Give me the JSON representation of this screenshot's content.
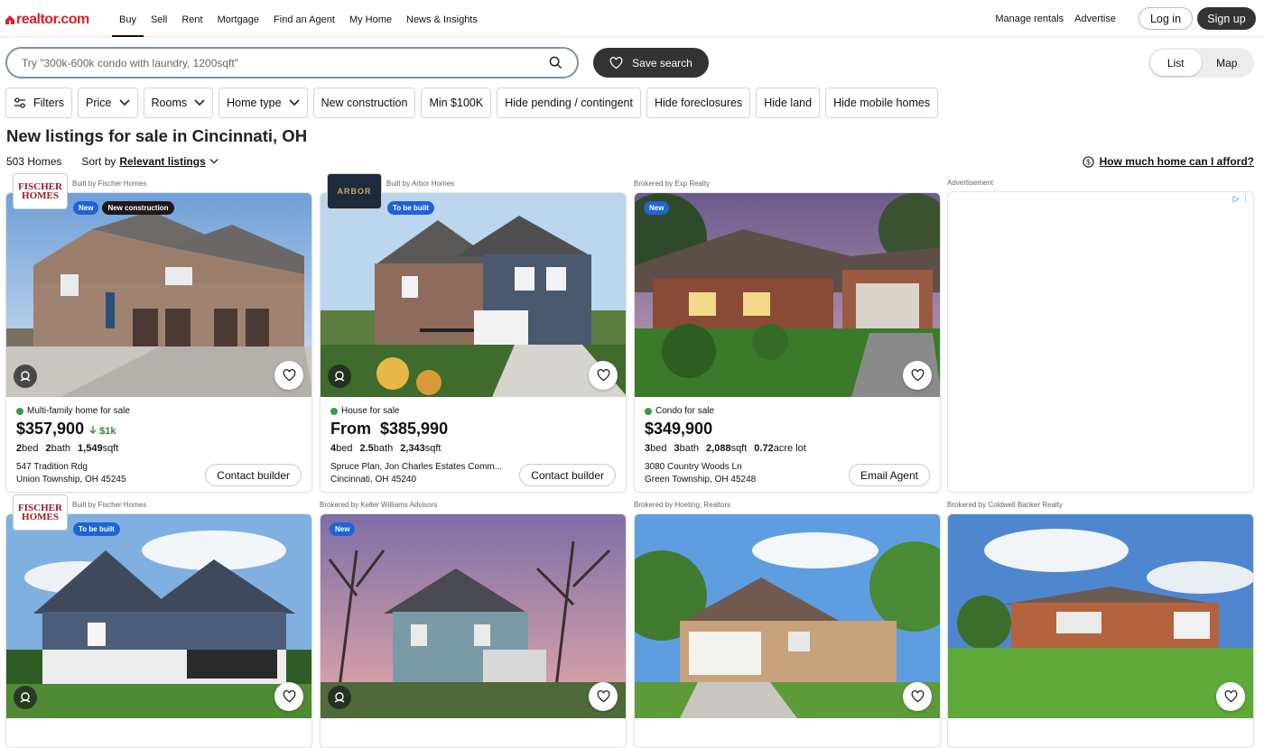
{
  "header": {
    "logo": "realtor.com",
    "nav": [
      "Buy",
      "Sell",
      "Rent",
      "Mortgage",
      "Find an Agent",
      "My Home",
      "News & Insights"
    ],
    "right_links": [
      "Manage rentals",
      "Advertise"
    ],
    "login": "Log in",
    "signup": "Sign up"
  },
  "search": {
    "placeholder": "Try \"300k-600k condo with laundry, 1200sqft\"",
    "save_search": "Save search",
    "view_list": "List",
    "view_map": "Map"
  },
  "filters": [
    "Filters",
    "Price",
    "Rooms",
    "Home type",
    "New construction",
    "Min $100K",
    "Hide pending / contingent",
    "Hide foreclosures",
    "Hide land",
    "Hide mobile homes"
  ],
  "page_title": "New listings for sale in Cincinnati, OH",
  "count": "503 Homes",
  "sort_label": "Sort by",
  "sort_value": "Relevant listings",
  "afford": "How much home can I afford?",
  "ad_label": "Advertisement",
  "listings": [
    {
      "broker": "Built by Fischer Homes",
      "builder_logo": "FISCHER HOMES",
      "badges": [
        "New",
        "New construction"
      ],
      "status": "Multi-family home for sale",
      "price": "$357,900",
      "price_drop": "$1k",
      "beds": "2",
      "baths": "2",
      "sqft": "1,549",
      "lot": "",
      "addr1": "547 Tradition Rdg",
      "addr2": "Union Township, OH 45245",
      "cta": "Contact builder",
      "scene": "townhouse"
    },
    {
      "broker": "Built by Arbor Homes",
      "builder_logo": "ARBOR",
      "badges": [
        "To be built"
      ],
      "status": "House for sale",
      "price": "From  $385,990",
      "price_drop": "",
      "beds": "4",
      "baths": "2.5",
      "sqft": "2,343",
      "lot": "",
      "addr1": "Spruce Plan, Jon Charles Estates Comm...",
      "addr2": "Cincinnati, OH 45240",
      "cta": "Contact builder",
      "scene": "twostory"
    },
    {
      "broker": "Brokered by Exp Realty",
      "builder_logo": "",
      "badges": [
        "New"
      ],
      "status": "Condo for sale",
      "price": "$349,900",
      "price_drop": "",
      "beds": "3",
      "baths": "3",
      "sqft": "2,088",
      "lot": "0.72",
      "addr1": "3080 Country Woods Ln",
      "addr2": "Green Township, OH 45248",
      "cta": "Email Agent",
      "scene": "ranch"
    },
    {
      "broker": "Built by Fischer Homes",
      "builder_logo": "FISCHER HOMES",
      "badges": [
        "To be built"
      ],
      "scene": "bluehouse"
    },
    {
      "broker": "Brokered by Keller Williams Advisors",
      "badges": [
        "New"
      ],
      "scene": "dusk"
    },
    {
      "broker": "Brokered by Hoeting, Realtors",
      "badges": [],
      "scene": "brickgarage"
    },
    {
      "broker": "Brokered by Coldwell Banker Realty",
      "badges": [],
      "scene": "redranch"
    }
  ],
  "colors": {
    "brand": "#d92228",
    "new_badge": "#1f63d4",
    "status_dot": "#3a9a43",
    "dark_button": "#333333"
  }
}
